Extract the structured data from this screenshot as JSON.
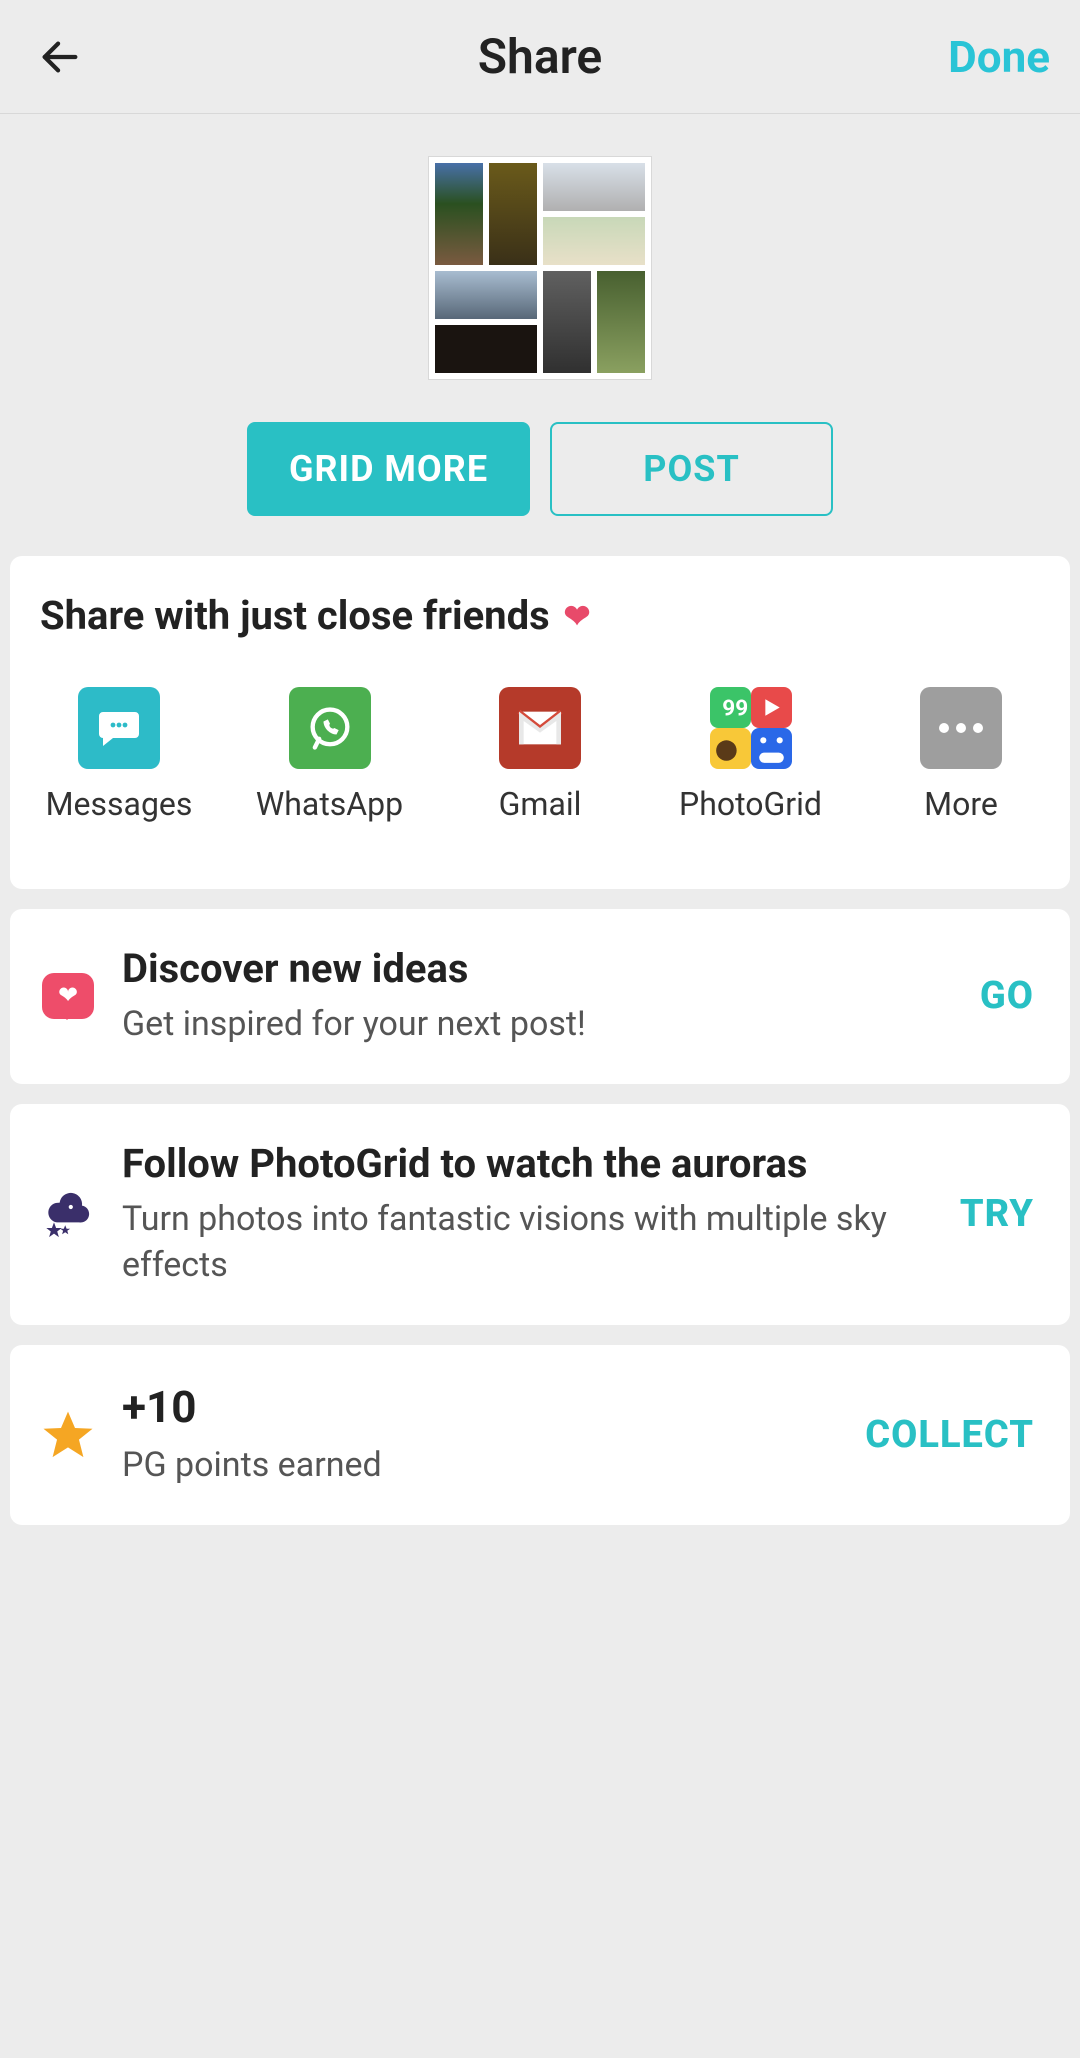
{
  "header": {
    "title": "Share",
    "done_label": "Done"
  },
  "actions": {
    "grid_more": "GRID MORE",
    "post": "POST"
  },
  "share_section": {
    "heading": "Share with just close friends",
    "options": [
      {
        "label": "Messages",
        "icon": "messages-icon"
      },
      {
        "label": "WhatsApp",
        "icon": "whatsapp-icon"
      },
      {
        "label": "Gmail",
        "icon": "gmail-icon"
      },
      {
        "label": "PhotoGrid",
        "icon": "photogrid-icon"
      },
      {
        "label": "More",
        "icon": "more-icon"
      }
    ]
  },
  "promos": [
    {
      "title": "Discover new ideas",
      "subtitle": "Get inspired for your next post!",
      "action": "GO",
      "icon": "heart-like-icon"
    },
    {
      "title": "Follow PhotoGrid to watch the auroras",
      "subtitle": "Turn photos into fantastic visions with multiple sky effects",
      "action": "TRY",
      "icon": "cloud-stars-icon"
    },
    {
      "title": "+10",
      "subtitle": "PG points earned",
      "action": "COLLECT",
      "icon": "star-icon"
    }
  ],
  "colors": {
    "accent": "#29c0c4",
    "accent_text": "#29c4d6"
  }
}
